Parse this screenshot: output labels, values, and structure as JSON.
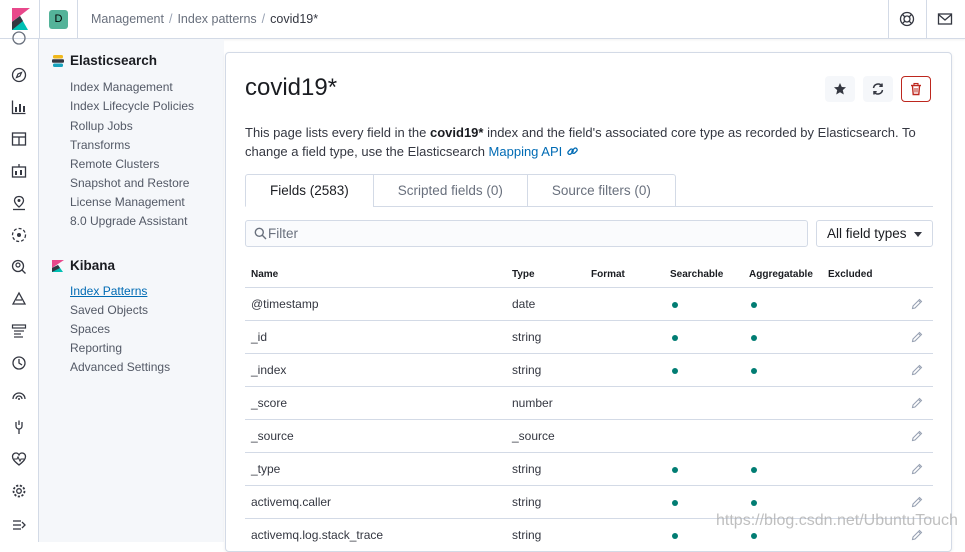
{
  "topbar": {
    "space_initial": "D",
    "breadcrumbs": [
      "Management",
      "Index patterns",
      "covid19*"
    ]
  },
  "sidebar": {
    "elasticsearch": {
      "title": "Elasticsearch",
      "items": [
        "Index Management",
        "Index Lifecycle Policies",
        "Rollup Jobs",
        "Transforms",
        "Remote Clusters",
        "Snapshot and Restore",
        "License Management",
        "8.0 Upgrade Assistant"
      ]
    },
    "kibana": {
      "title": "Kibana",
      "items": [
        "Index Patterns",
        "Saved Objects",
        "Spaces",
        "Reporting",
        "Advanced Settings"
      ],
      "active": "Index Patterns"
    }
  },
  "main": {
    "title": "covid19*",
    "desc_prefix": "This page lists every field in the ",
    "desc_bold": "covid19*",
    "desc_mid": " index and the field's associated core type as recorded by Elasticsearch. To change a field type, use the Elasticsearch ",
    "desc_link": "Mapping API",
    "tabs": [
      "Fields (2583)",
      "Scripted fields (0)",
      "Source filters (0)"
    ],
    "filter_placeholder": "Filter",
    "field_type_select": "All field types",
    "columns": [
      "Name",
      "Type",
      "Format",
      "Searchable",
      "Aggregatable",
      "Excluded"
    ],
    "rows": [
      {
        "name": "@timestamp",
        "type": "date",
        "format": "",
        "searchable": true,
        "aggregatable": true,
        "excluded": false
      },
      {
        "name": "_id",
        "type": "string",
        "format": "",
        "searchable": true,
        "aggregatable": true,
        "excluded": false
      },
      {
        "name": "_index",
        "type": "string",
        "format": "",
        "searchable": true,
        "aggregatable": true,
        "excluded": false
      },
      {
        "name": "_score",
        "type": "number",
        "format": "",
        "searchable": false,
        "aggregatable": false,
        "excluded": false
      },
      {
        "name": "_source",
        "type": "_source",
        "format": "",
        "searchable": false,
        "aggregatable": false,
        "excluded": false
      },
      {
        "name": "_type",
        "type": "string",
        "format": "",
        "searchable": true,
        "aggregatable": true,
        "excluded": false
      },
      {
        "name": "activemq.caller",
        "type": "string",
        "format": "",
        "searchable": true,
        "aggregatable": true,
        "excluded": false
      },
      {
        "name": "activemq.log.stack_trace",
        "type": "string",
        "format": "",
        "searchable": true,
        "aggregatable": true,
        "excluded": false
      }
    ]
  },
  "watermark": "https://blog.csdn.net/UbuntuTouch",
  "colors": {
    "link": "#006bb4",
    "dot": "#017d73",
    "danger": "#bd271e",
    "space_badge": "#54b399",
    "sidebar_bg": "#f5f7fa"
  }
}
